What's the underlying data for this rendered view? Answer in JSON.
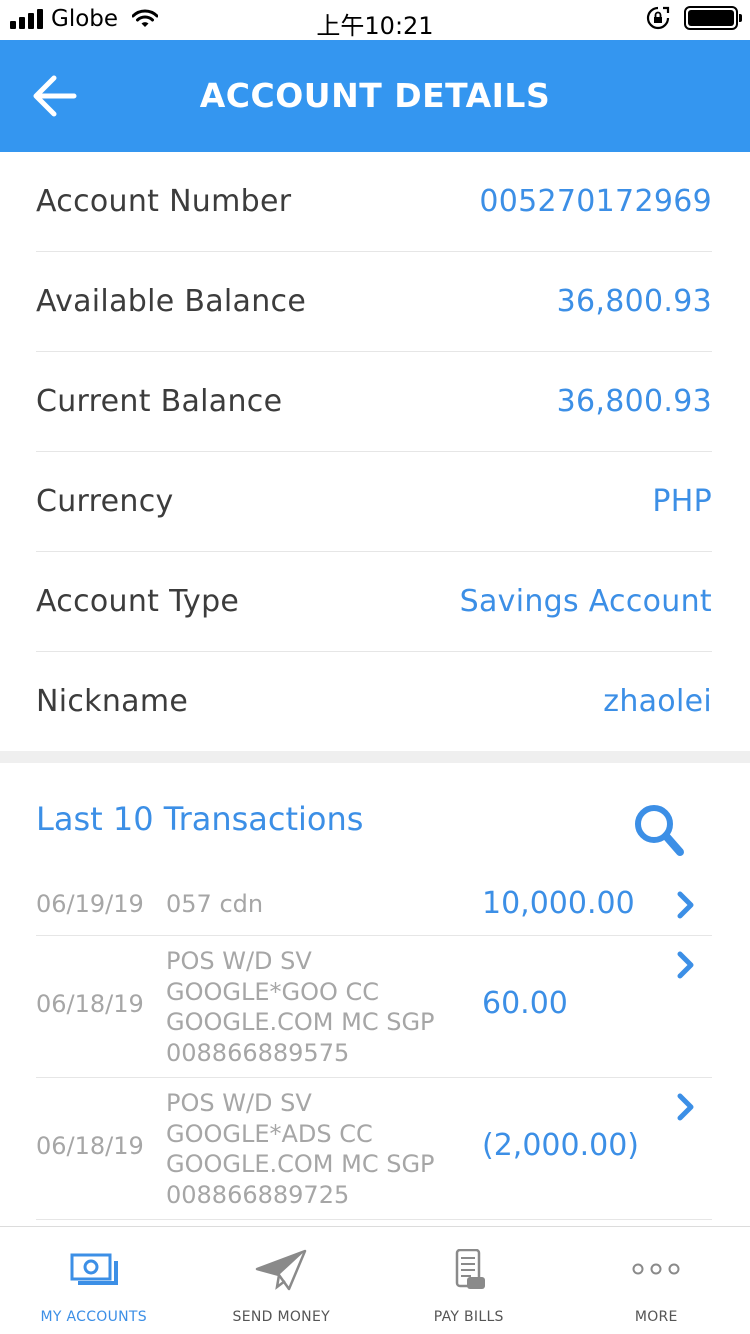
{
  "status_bar": {
    "carrier": "Globe",
    "time": "上午10:21"
  },
  "header": {
    "title": "ACCOUNT DETAILS",
    "back_icon": "arrow-left-icon"
  },
  "account_details": [
    {
      "label": "Account Number",
      "value": "005270172969"
    },
    {
      "label": "Available Balance",
      "value": "36,800.93"
    },
    {
      "label": "Current Balance",
      "value": "36,800.93"
    },
    {
      "label": "Currency",
      "value": "PHP"
    },
    {
      "label": "Account Type",
      "value": "Savings Account"
    },
    {
      "label": "Nickname",
      "value": "zhaolei"
    }
  ],
  "transactions": {
    "title": "Last 10 Transactions",
    "search_icon": "search-icon",
    "items": [
      {
        "date": "06/19/19",
        "description": [
          "057 cdn"
        ],
        "amount": "10,000.00"
      },
      {
        "date": "06/18/19",
        "description": [
          "POS W/D SV",
          "GOOGLE*GOO CC",
          "GOOGLE.COM MC SGP",
          "008866889575"
        ],
        "amount": "60.00"
      },
      {
        "date": "06/18/19",
        "description": [
          "POS W/D SV",
          "GOOGLE*ADS CC",
          "GOOGLE.COM MC SGP",
          "008866889725"
        ],
        "amount": "(2,000.00)"
      }
    ]
  },
  "bottom_nav": [
    {
      "label": "MY ACCOUNTS",
      "icon": "cash-icon",
      "active": true
    },
    {
      "label": "SEND MONEY",
      "icon": "paper-plane-icon",
      "active": false
    },
    {
      "label": "PAY BILLS",
      "icon": "receipt-icon",
      "active": false
    },
    {
      "label": "MORE",
      "icon": "more-dots-icon",
      "active": false
    }
  ],
  "colors": {
    "header_bg": "#3496f0",
    "accent": "#3c8fe6",
    "muted_text": "#a6a6a6"
  }
}
